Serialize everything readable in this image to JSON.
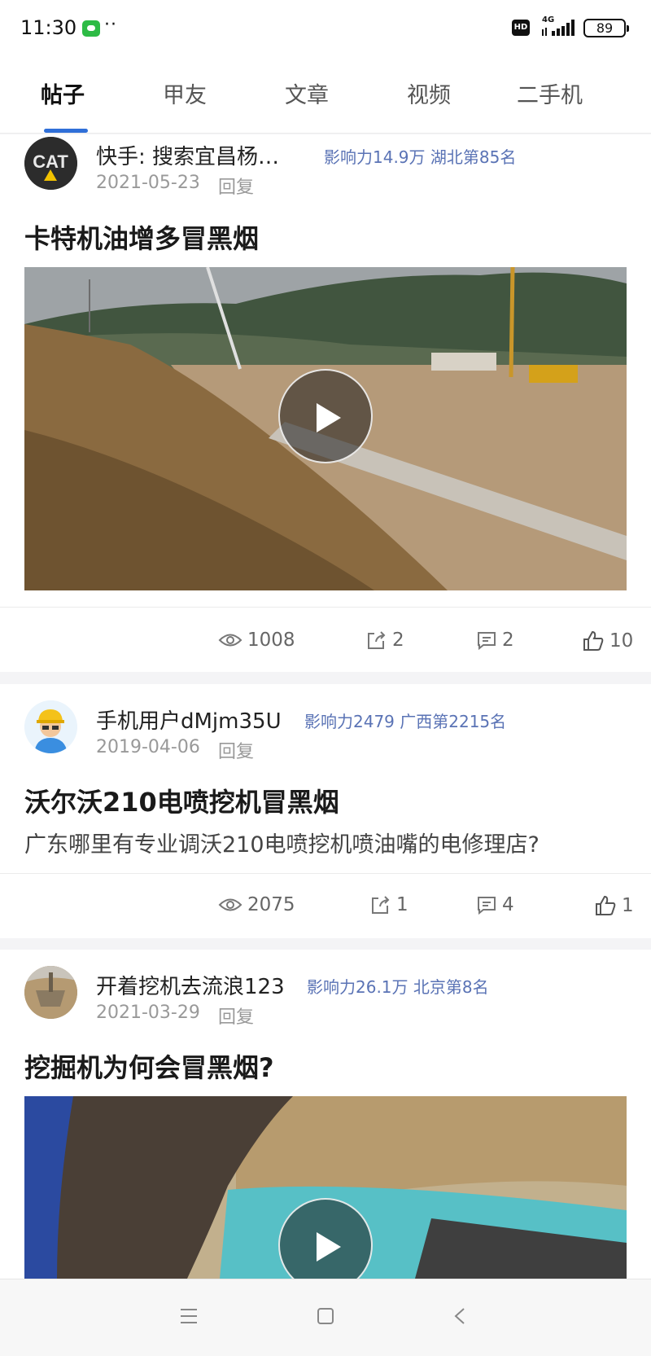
{
  "status_bar": {
    "time": "11:30",
    "dots": "··",
    "hd": "HD",
    "network": "4G",
    "battery": "89",
    "notification_icon": "wechat-icon"
  },
  "tabs": [
    {
      "label": "帖子",
      "active": true
    },
    {
      "label": "甲友",
      "active": false
    },
    {
      "label": "文章",
      "active": false
    },
    {
      "label": "视频",
      "active": false
    },
    {
      "label": "二手机",
      "active": false
    }
  ],
  "posts": [
    {
      "username": "快手: 搜索宜昌杨…",
      "influence": "影响力14.9万 湖北第85名",
      "date": "2021-05-23",
      "action": "回复",
      "title": "卡特机油增多冒黑烟",
      "views": "1008",
      "shares": "2",
      "comments": "2",
      "likes": "10"
    },
    {
      "username": "手机用户dMjm35U",
      "influence": "影响力2479 广西第2215名",
      "date": "2019-04-06",
      "action": "回复",
      "title": "沃尔沃210电喷挖机冒黑烟",
      "excerpt": "广东哪里有专业调沃210电喷挖机喷油嘴的电修理店?",
      "views": "2075",
      "shares": "1",
      "comments": "4",
      "likes": "1"
    },
    {
      "username": "开着挖机去流浪123",
      "influence": "影响力26.1万 北京第8名",
      "date": "2021-03-29",
      "action": "回复",
      "title": "挖掘机为何会冒黑烟?"
    }
  ],
  "nav_bar": {
    "icons": [
      "menu-icon",
      "home-square-icon",
      "back-icon"
    ]
  },
  "colors": {
    "accent": "#2f6fd8",
    "influence_text": "#5a73b5",
    "background": "#f4f4f6"
  }
}
